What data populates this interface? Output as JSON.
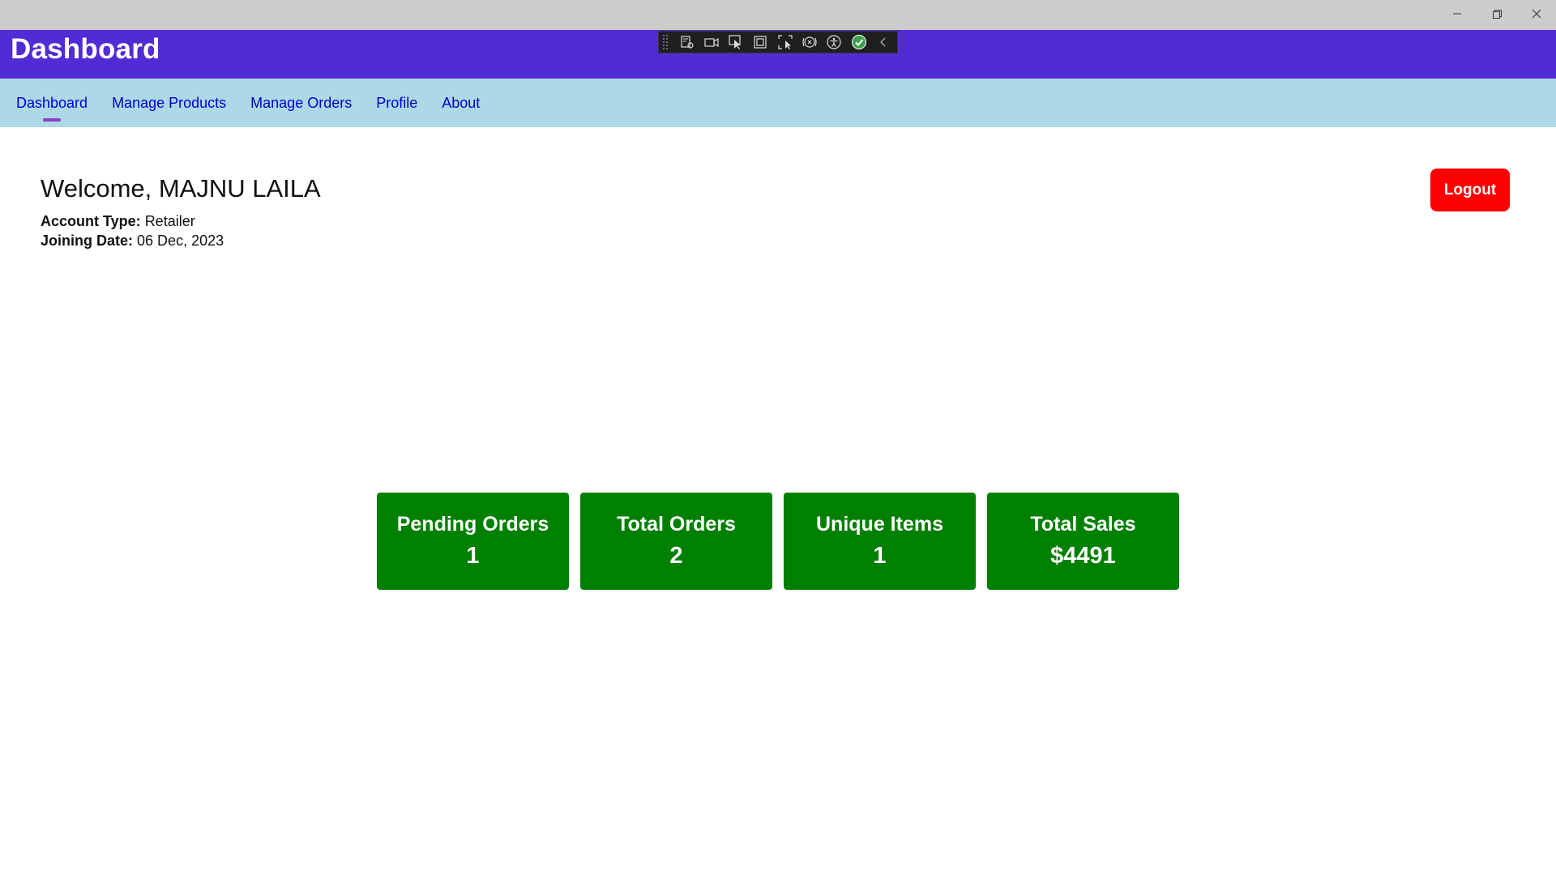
{
  "window": {
    "controls": [
      "minimize-icon",
      "restore-icon",
      "close-icon"
    ]
  },
  "header": {
    "title": "Dashboard",
    "background": "#512bd4"
  },
  "debug_toolbar": {
    "icons": [
      "live-visual-tree-icon",
      "record-icon",
      "select-element-icon",
      "display-layout-adorners-icon",
      "track-focus-icon",
      "binding-failures-icon",
      "accessibility-checker-icon",
      "check-icon",
      "collapse-chevron-icon"
    ]
  },
  "nav": {
    "background": "#add8e6",
    "items": [
      {
        "label": "Dashboard",
        "active": true
      },
      {
        "label": "Manage Products",
        "active": false
      },
      {
        "label": "Manage Orders",
        "active": false
      },
      {
        "label": "Profile",
        "active": false
      },
      {
        "label": "About",
        "active": false
      }
    ]
  },
  "user": {
    "welcome": "Welcome, MAJNU LAILA",
    "account_type_label": "Account Type:",
    "account_type": "Retailer",
    "joining_date_label": "Joining Date:",
    "joining_date": "06 Dec, 2023"
  },
  "logout": {
    "label": "Logout",
    "color": "#ff0000"
  },
  "stats": {
    "card_color": "#008000",
    "cards": [
      {
        "label": "Pending Orders",
        "value": "1"
      },
      {
        "label": "Total Orders",
        "value": "2"
      },
      {
        "label": "Unique Items",
        "value": "1"
      },
      {
        "label": "Total Sales",
        "value": "$4491"
      }
    ]
  }
}
